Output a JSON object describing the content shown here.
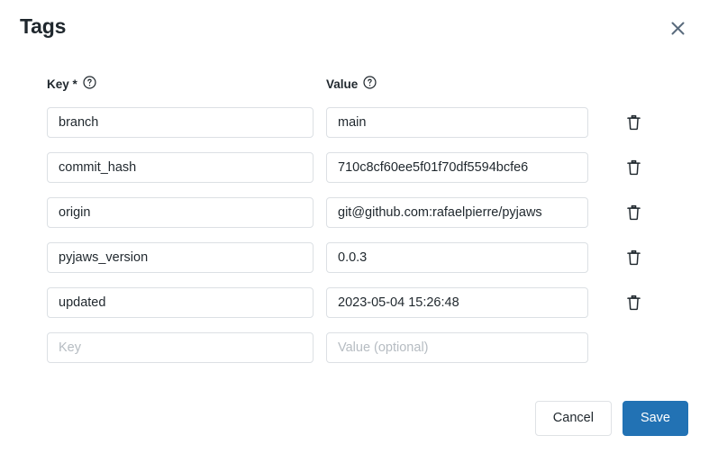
{
  "dialog": {
    "title": "Tags",
    "close_icon": "close-icon"
  },
  "columns": {
    "key": {
      "label": "Key *",
      "help_icon": "help-circle-icon"
    },
    "value": {
      "label": "Value",
      "help_icon": "help-circle-icon"
    }
  },
  "placeholders": {
    "key": "Key",
    "value": "Value (optional)"
  },
  "rows": [
    {
      "key": "branch",
      "value": "main",
      "delete_icon": "trash-icon",
      "deletable": true
    },
    {
      "key": "commit_hash",
      "value": "710c8cf60ee5f01f70df5594bcfe6",
      "delete_icon": "trash-icon",
      "deletable": true
    },
    {
      "key": "origin",
      "value": "git@github.com:rafaelpierre/pyjaws",
      "delete_icon": "trash-icon",
      "deletable": true
    },
    {
      "key": "pyjaws_version",
      "value": "0.0.3",
      "delete_icon": "trash-icon",
      "deletable": true
    },
    {
      "key": "updated",
      "value": "2023-05-04 15:26:48",
      "delete_icon": "trash-icon",
      "deletable": true
    },
    {
      "key": "",
      "value": "",
      "delete_icon": "",
      "deletable": false
    }
  ],
  "footer": {
    "cancel_label": "Cancel",
    "save_label": "Save"
  },
  "colors": {
    "primary": "#2272b4",
    "text": "#1f272d",
    "border": "#dce0e4",
    "placeholder": "#b6bcc2",
    "close_icon": "#5a6b7d"
  }
}
